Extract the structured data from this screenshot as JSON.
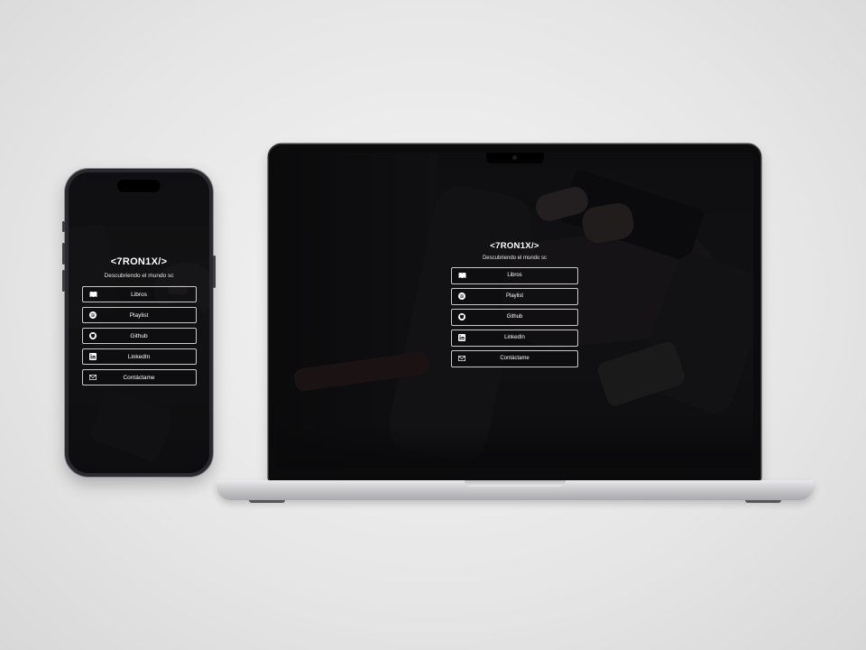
{
  "site": {
    "title": "<7RON1X/>",
    "subtitle": "Descubriendo el mundo sc",
    "links": [
      {
        "label": "Libros",
        "icon": "book-icon"
      },
      {
        "label": "Playlist",
        "icon": "spotify-icon"
      },
      {
        "label": "Github",
        "icon": "github-icon"
      },
      {
        "label": "LinkedIn",
        "icon": "linkedin-icon"
      },
      {
        "label": "Contáctame",
        "icon": "mail-icon"
      }
    ]
  },
  "colors": {
    "background": "#e6e6e6",
    "screen": "#0c0c0d",
    "text": "#ffffff",
    "button_border": "#c8c8c8"
  }
}
